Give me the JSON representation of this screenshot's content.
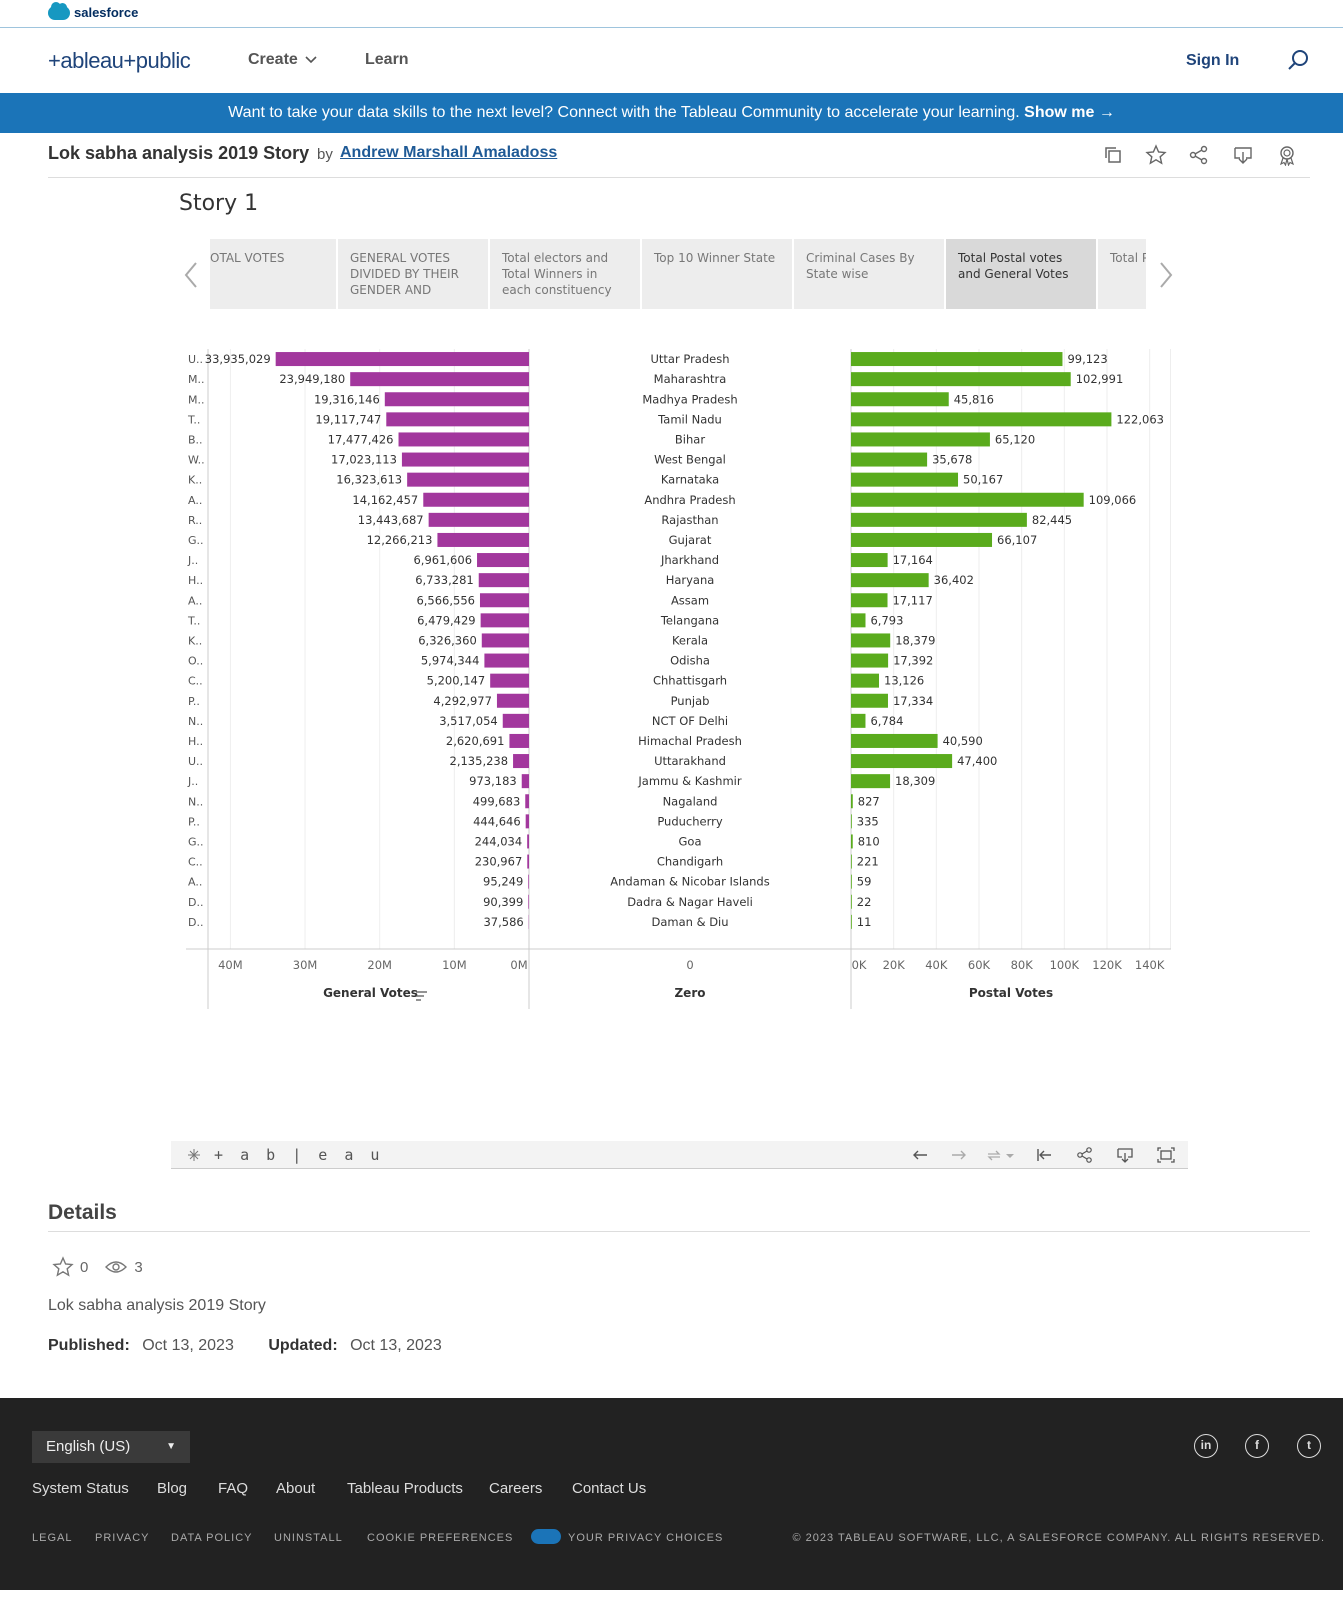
{
  "salesforce": {
    "brand": "salesforce"
  },
  "nav": {
    "logo": "+ableau+public",
    "create": "Create",
    "learn": "Learn",
    "sign_in": "Sign In"
  },
  "banner": {
    "text": "Want to take your data skills to the next level? Connect with the Tableau Community to accelerate your learning.",
    "cta": "Show me →"
  },
  "viz": {
    "title": "Lok sabha analysis 2019 Story",
    "by": "by",
    "author": "Andrew Marshall Amaladoss"
  },
  "story": {
    "title": "Story 1",
    "points": [
      "OTAL VOTES",
      "GENERAL VOTES DIVIDED BY THEIR GENDER AND",
      "Total electors and Total Winners in each constituency",
      "Top 10 Winner State",
      "Criminal Cases By State wise",
      "Total Postal votes and General Votes",
      "Total P each P"
    ],
    "active_index": 5
  },
  "chart_data": {
    "type": "bar",
    "states": [
      "Uttar Pradesh",
      "Maharashtra",
      "Madhya Pradesh",
      "Tamil Nadu",
      "Bihar",
      "West Bengal",
      "Karnataka",
      "Andhra Pradesh",
      "Rajasthan",
      "Gujarat",
      "Jharkhand",
      "Haryana",
      "Assam",
      "Telangana",
      "Kerala",
      "Odisha",
      "Chhattisgarh",
      "Punjab",
      "NCT OF Delhi",
      "Himachal Pradesh",
      "Uttarakhand",
      "Jammu & Kashmir",
      "Nagaland",
      "Puducherry",
      "Goa",
      "Chandigarh",
      "Andaman & Nicobar Islands",
      "Dadra & Nagar Haveli",
      "Daman & Diu"
    ],
    "abbrev": [
      "U..",
      "M..",
      "M..",
      "T..",
      "B..",
      "W..",
      "K..",
      "A..",
      "R..",
      "G..",
      "J..",
      "H..",
      "A..",
      "T..",
      "K..",
      "O..",
      "C..",
      "P..",
      "N..",
      "H..",
      "U..",
      "J..",
      "N..",
      "P..",
      "G..",
      "C..",
      "A..",
      "D..",
      "D.."
    ],
    "general_votes": [
      33935029,
      23949180,
      19316146,
      19117747,
      17477426,
      17023113,
      16323613,
      14162457,
      13443687,
      12266213,
      6961606,
      6733281,
      6566556,
      6479429,
      6326360,
      5974344,
      5200147,
      4292977,
      3517054,
      2620691,
      2135238,
      973183,
      499683,
      444646,
      244034,
      230967,
      95249,
      90399,
      37586
    ],
    "general_labels": [
      "33,935,029",
      "23,949,180",
      "19,316,146",
      "19,117,747",
      "17,477,426",
      "17,023,113",
      "16,323,613",
      "14,162,457",
      "13,443,687",
      "12,266,213",
      "6,961,606",
      "6,733,281",
      "6,566,556",
      "6,479,429",
      "6,326,360",
      "5,974,344",
      "5,200,147",
      "4,292,977",
      "3,517,054",
      "2,620,691",
      "2,135,238",
      "973,183",
      "499,683",
      "444,646",
      "244,034",
      "230,967",
      "95,249",
      "90,399",
      "37,586"
    ],
    "postal_votes": [
      99123,
      102991,
      45816,
      122063,
      65120,
      35678,
      50167,
      109066,
      82445,
      66107,
      17164,
      36402,
      17117,
      6793,
      18379,
      17392,
      13126,
      17334,
      6784,
      40590,
      47400,
      18309,
      827,
      335,
      810,
      221,
      59,
      22,
      11
    ],
    "postal_labels": [
      "99,123",
      "102,991",
      "45,816",
      "122,063",
      "65,120",
      "35,678",
      "50,167",
      "109,066",
      "82,445",
      "66,107",
      "17,164",
      "36,402",
      "17,117",
      "6,793",
      "18,379",
      "17,392",
      "13,126",
      "17,334",
      "6,784",
      "40,590",
      "47,400",
      "18,309",
      "827",
      "335",
      "810",
      "221",
      "59",
      "22",
      "11"
    ],
    "general_axis": {
      "label": "General Votes",
      "ticks": [
        "40M",
        "30M",
        "20M",
        "10M",
        "0M"
      ],
      "tick_values": [
        40000000,
        30000000,
        20000000,
        10000000,
        0
      ],
      "max": 43000000
    },
    "zero_axis": {
      "label": "Zero",
      "ticks": [
        "0"
      ]
    },
    "postal_axis": {
      "label": "Postal Votes",
      "ticks": [
        "0K",
        "20K",
        "40K",
        "60K",
        "80K",
        "100K",
        "120K",
        "140K"
      ],
      "tick_values": [
        0,
        20000,
        40000,
        60000,
        80000,
        100000,
        120000,
        140000
      ],
      "max": 150000
    },
    "colors": {
      "general": "#a2379d",
      "postal": "#5aab1d"
    }
  },
  "toolbar": {
    "brand": "+ a b | e a u"
  },
  "details": {
    "heading": "Details",
    "favorites": "0",
    "views": "3",
    "description": "Lok sabha analysis 2019 Story",
    "published_label": "Published:",
    "published": "Oct 13, 2023",
    "updated_label": "Updated:",
    "updated": "Oct 13, 2023"
  },
  "footer": {
    "language": "English (US)",
    "links": [
      "System Status",
      "Blog",
      "FAQ",
      "About",
      "Tableau Products",
      "Careers",
      "Contact Us"
    ],
    "legal": [
      "LEGAL",
      "PRIVACY",
      "DATA POLICY",
      "UNINSTALL",
      "COOKIE PREFERENCES",
      "YOUR PRIVACY CHOICES"
    ],
    "copyright": "© 2023 TABLEAU SOFTWARE, LLC, A SALESFORCE COMPANY. ALL RIGHTS RESERVED.",
    "social": [
      "in",
      "f",
      "t"
    ]
  }
}
